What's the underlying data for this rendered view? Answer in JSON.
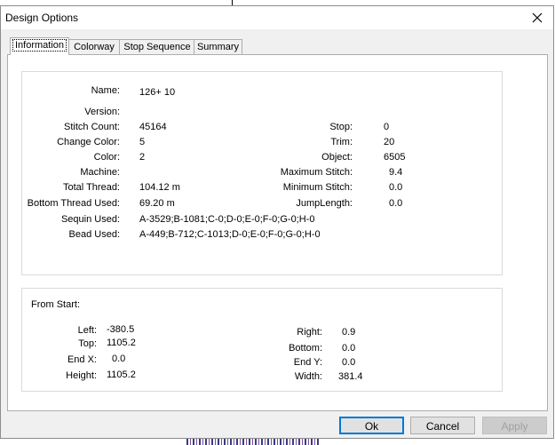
{
  "dialog": {
    "title": "Design Options",
    "close_glyph": "✕"
  },
  "tabs": [
    {
      "label": "Information"
    },
    {
      "label": "Colorway"
    },
    {
      "label": "Stop Sequence"
    },
    {
      "label": "Summary"
    }
  ],
  "info": {
    "name_label": "Name:",
    "name": "126+ 10",
    "version_label": "Version:",
    "version": "",
    "stitch_count_label": "Stitch Count:",
    "stitch_count": "45164",
    "change_color_label": "Change Color:",
    "change_color": "5",
    "color_label": "Color:",
    "color": "2",
    "machine_label": "Machine:",
    "machine": "",
    "total_thread_label": "Total Thread:",
    "total_thread": "104.12 m",
    "bottom_thread_label": "Bottom Thread Used:",
    "bottom_thread": "69.20 m",
    "sequin_label": "Sequin Used:",
    "sequin": "A-3529;B-1081;C-0;D-0;E-0;F-0;G-0;H-0",
    "bead_label": "Bead Used:",
    "bead": "A-449;B-712;C-1013;D-0;E-0;F-0;G-0;H-0",
    "stop_label": "Stop:",
    "stop": "0",
    "trim_label": "Trim:",
    "trim": "20",
    "object_label": "Object:",
    "object": "6505",
    "max_stitch_label": "Maximum Stitch:",
    "max_stitch": "9.4",
    "min_stitch_label": "Minimum Stitch:",
    "min_stitch": "0.0",
    "jump_label": "JumpLength:",
    "jump": "0.0"
  },
  "from_start": {
    "title": "From Start:",
    "left_label": "Left:",
    "left": "-380.5",
    "top_label": "Top:",
    "top": "1105.2",
    "endx_label": "End X:",
    "endx": "0.0",
    "height_label": "Height:",
    "height": "1105.2",
    "right_label": "Right:",
    "right": "0.9",
    "bottom_label": "Bottom:",
    "bottom": "0.0",
    "endy_label": "End Y:",
    "endy": "0.0",
    "width_label": "Width:",
    "width": "381.4"
  },
  "buttons": {
    "ok": "Ok",
    "cancel": "Cancel",
    "apply": "Apply"
  }
}
